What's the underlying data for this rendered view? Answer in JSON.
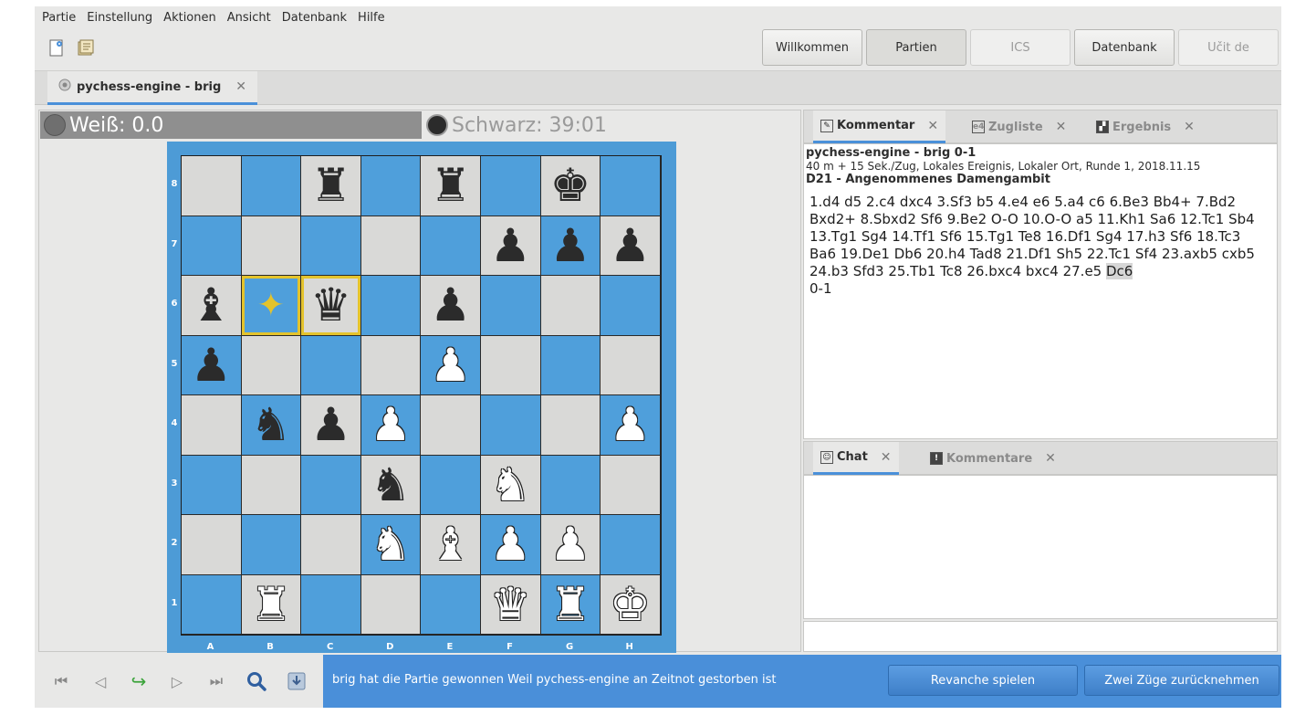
{
  "menu": [
    "Partie",
    "Einstellung",
    "Aktionen",
    "Ansicht",
    "Datenbank",
    "Hilfe"
  ],
  "toolbar": {
    "icons": [
      "new-game-icon",
      "open-database-icon"
    ],
    "perspectives": [
      {
        "label": "Willkommen",
        "state": "normal"
      },
      {
        "label": "Partien",
        "state": "active"
      },
      {
        "label": "ICS",
        "state": "disabled"
      },
      {
        "label": "Datenbank",
        "state": "normal"
      },
      {
        "label": "Učit de",
        "state": "disabled"
      }
    ]
  },
  "doc_tab": {
    "label": "pychess-engine - brig"
  },
  "clocks": {
    "white": "Weiß: 0.0",
    "black": "Schwarz: 39:01"
  },
  "board": {
    "ranks": [
      "8",
      "7",
      "6",
      "5",
      "4",
      "3",
      "2",
      "1"
    ],
    "files": [
      "A",
      "B",
      "C",
      "D",
      "E",
      "F",
      "G",
      "H"
    ],
    "position": [
      [
        "",
        "",
        "bR",
        "",
        "bR",
        "",
        "bK",
        ""
      ],
      [
        "",
        "",
        "",
        "",
        "",
        "bP",
        "bP",
        "bP"
      ],
      [
        "bB",
        "*",
        "bQ",
        "",
        "bP",
        "",
        "",
        ""
      ],
      [
        "bP",
        "",
        "",
        "",
        "wP",
        "",
        "",
        ""
      ],
      [
        "",
        "bN",
        "bP",
        "wP",
        "",
        "",
        "",
        "wP"
      ],
      [
        "",
        "",
        "",
        "bN",
        "",
        "wN",
        "",
        ""
      ],
      [
        "",
        "",
        "",
        "wN",
        "wB",
        "wP",
        "wP",
        ""
      ],
      [
        "",
        "wR",
        "",
        "",
        "",
        "wQ",
        "wR",
        "wK"
      ]
    ],
    "last_move": [
      "b6",
      "c6"
    ]
  },
  "panel_top": {
    "tabs": [
      {
        "label": "Kommentar",
        "icon": "pencil-icon",
        "active": true
      },
      {
        "label": "Zugliste",
        "icon": "e4-icon",
        "active": false
      },
      {
        "label": "Ergebnis",
        "icon": "score-icon",
        "active": false
      }
    ],
    "header1": "pychess-engine - brig 0-1",
    "header2": "40 m + 15 Sek./Zug, Lokales Ereignis, Lokaler Ort, Runde 1, 2018.11.15",
    "header3": "D21 - Angenommenes Damengambit",
    "moves_pre": "1.d4 d5 2.c4 dxc4 3.Sf3 b5 4.e4 e6 5.a4 c6 6.Be3 Bb4+ 7.Bd2 Bxd2+ 8.Sbxd2 Sf6 9.Be2 O-O 10.O-O a5 11.Kh1 Sa6 12.Tc1 Sb4 13.Tg1 Sg4 14.Tf1 Sf6 15.Tg1 Te8 16.Df1 Sg4 17.h3 Sf6 18.Tc3 Ba6 19.De1 Db6 20.h4 Tad8 21.Df1 Sh5 22.Tc1 Sf4 23.axb5 cxb5 24.b3 Sfd3 25.Tb1 Tc8 26.bxc4 bxc4 27.e5",
    "moves_current": "Dc6",
    "result": "0-1"
  },
  "panel_bottom": {
    "tabs": [
      {
        "label": "Chat",
        "icon": "chat-icon",
        "active": true
      },
      {
        "label": "Kommentare",
        "icon": "exclamation-icon",
        "active": false
      }
    ]
  },
  "bottom": {
    "nav_icons": [
      "first-move-icon",
      "previous-move-icon",
      "redo-icon",
      "next-move-icon",
      "last-move-icon",
      "search-icon",
      "save-icon"
    ],
    "message": "brig hat die Partie gewonnen Weil pychess-engine an Zeitnot gestorben ist",
    "rematch": "Revanche spielen",
    "undo_two": "Zwei Züge zurücknehmen"
  },
  "colors": {
    "accent": "#4a90d9",
    "infobar": "#4a8fd9",
    "board_dark": "#4f9fdb",
    "board_light": "#d9d9d7",
    "highlight": "#e4c32c"
  }
}
